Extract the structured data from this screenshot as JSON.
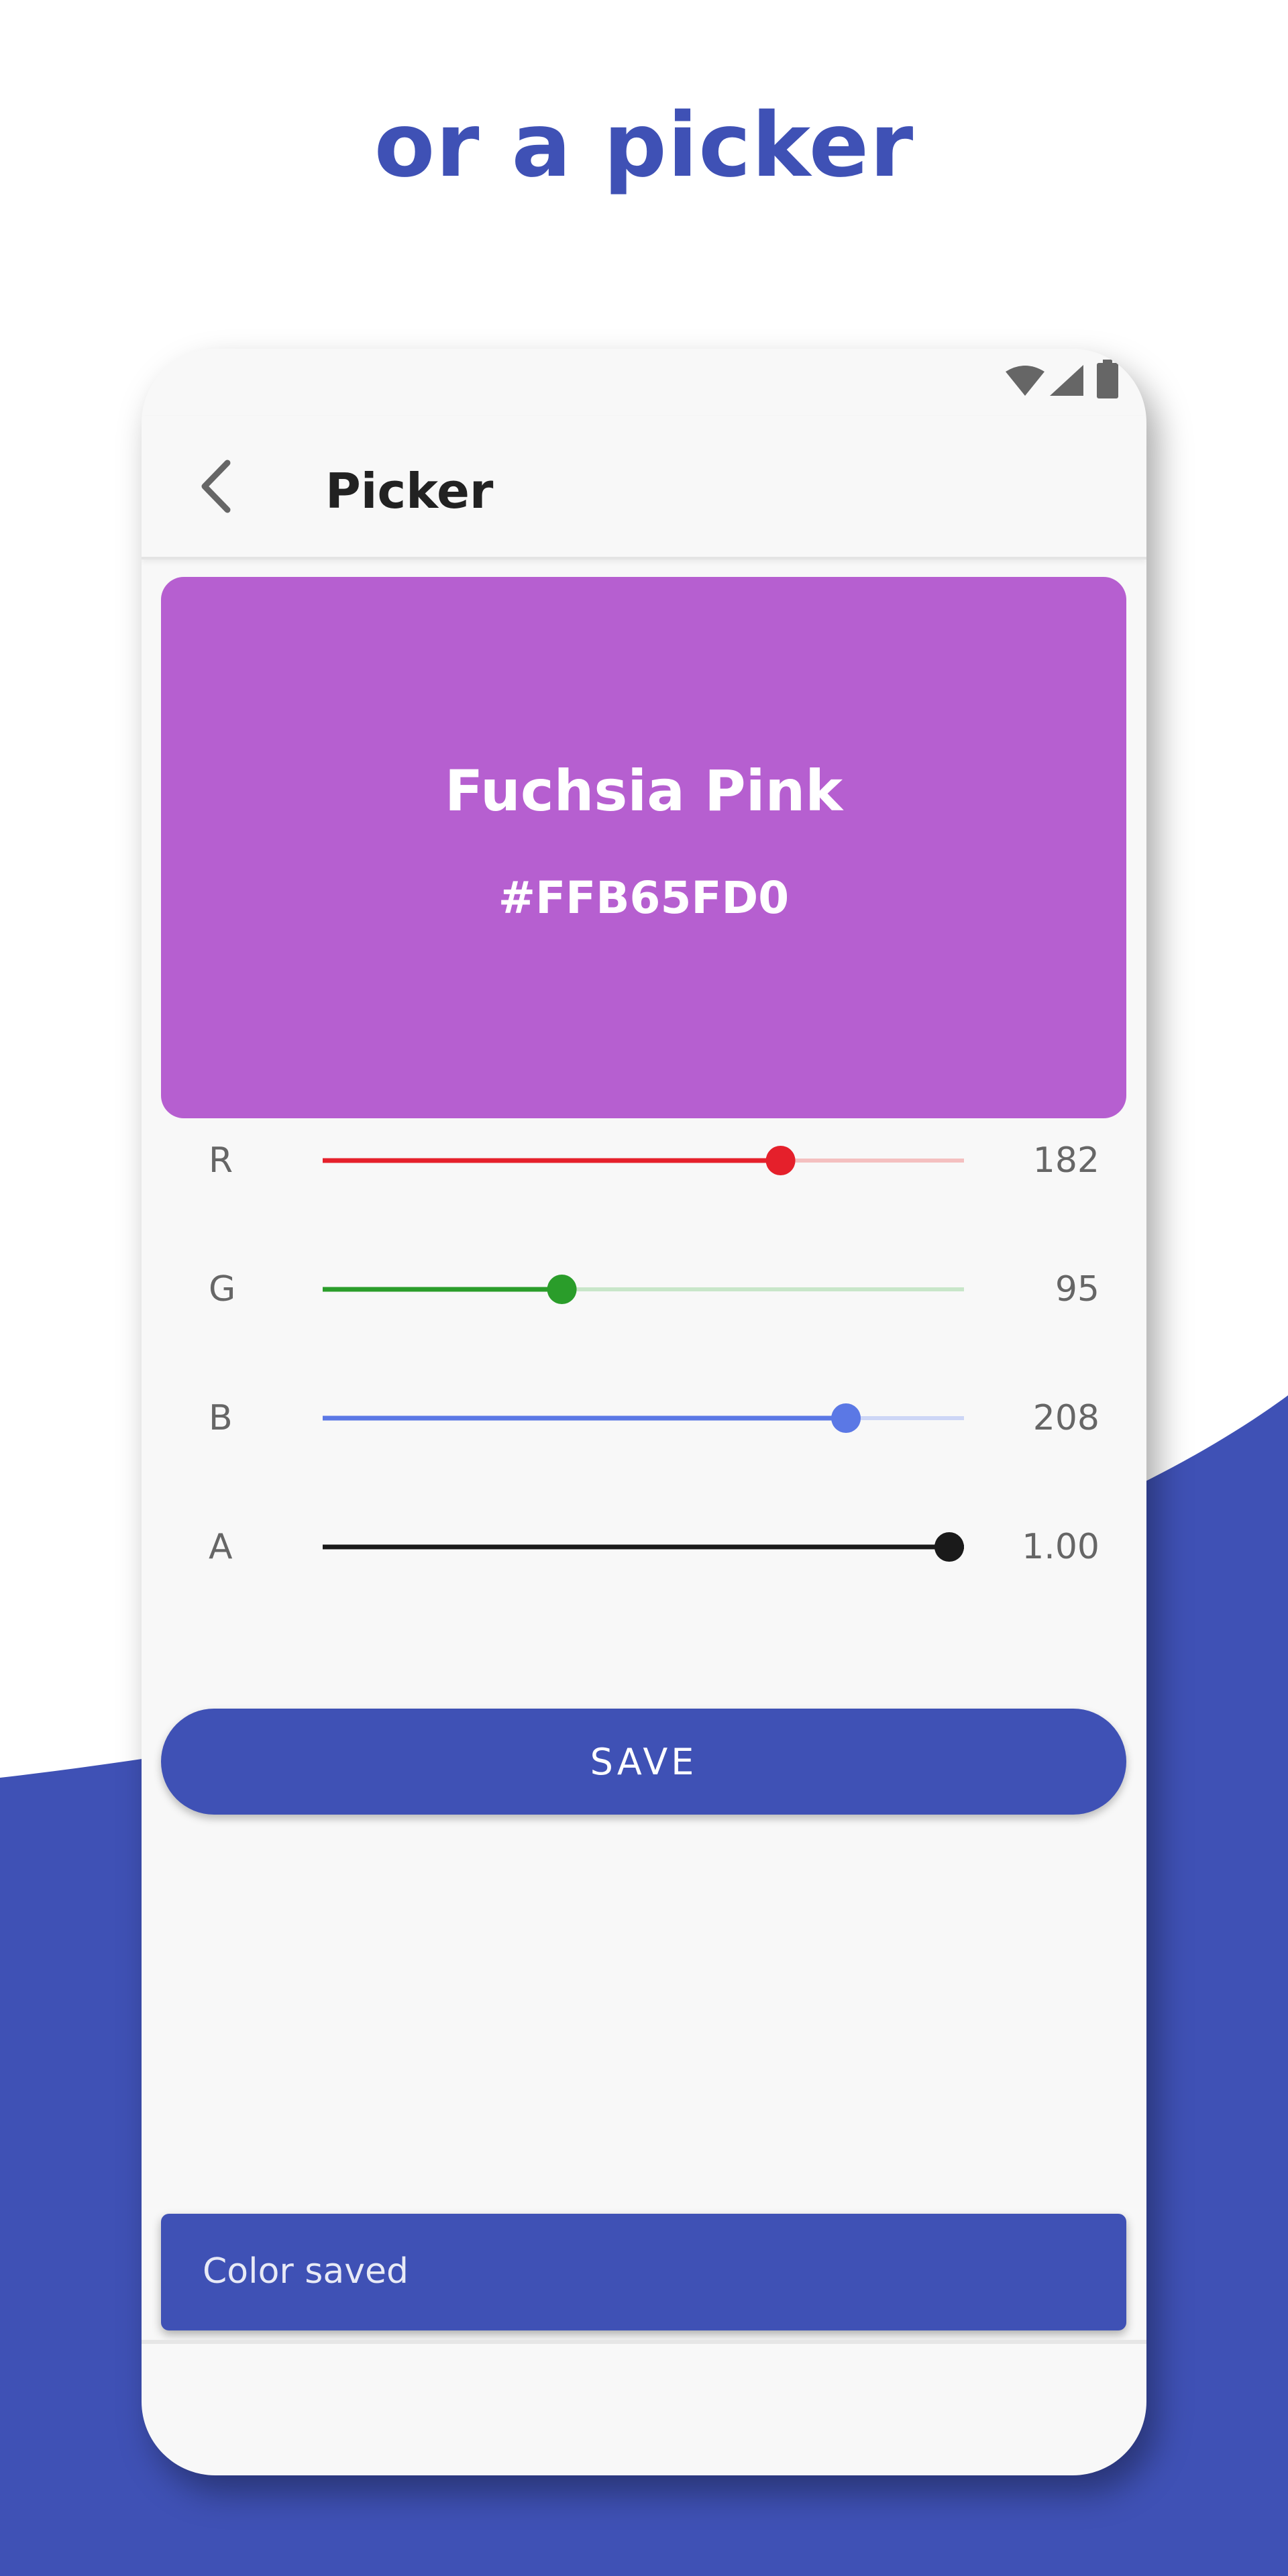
{
  "headline": "or a picker",
  "colors": {
    "brand": "#3f51b5",
    "background": "#ffffff",
    "phone_surface": "#f8f8f8"
  },
  "status_bar": {
    "icons": [
      "wifi-icon",
      "cellular-signal-icon",
      "battery-icon"
    ]
  },
  "app_bar": {
    "title": "Picker",
    "back_icon": "chevron-left-icon"
  },
  "swatch": {
    "name": "Fuchsia Pink",
    "hex": "#FFB65FD0",
    "color": "#b65fd0"
  },
  "sliders": [
    {
      "label": "R",
      "value_text": "182",
      "fraction": 0.714,
      "active_color": "#e5202b",
      "inactive_color": "#f4c0c0"
    },
    {
      "label": "G",
      "value_text": "95",
      "fraction": 0.373,
      "active_color": "#2a9d2a",
      "inactive_color": "#c8e6c9"
    },
    {
      "label": "B",
      "value_text": "208",
      "fraction": 0.816,
      "active_color": "#5b78e5",
      "inactive_color": "#cdd6f6"
    },
    {
      "label": "A",
      "value_text": "1.00",
      "fraction": 1.0,
      "active_color": "#1a1a1a",
      "inactive_color": "#1a1a1a"
    }
  ],
  "save_button": {
    "label": "SAVE"
  },
  "snackbar": {
    "message": "Color saved"
  }
}
